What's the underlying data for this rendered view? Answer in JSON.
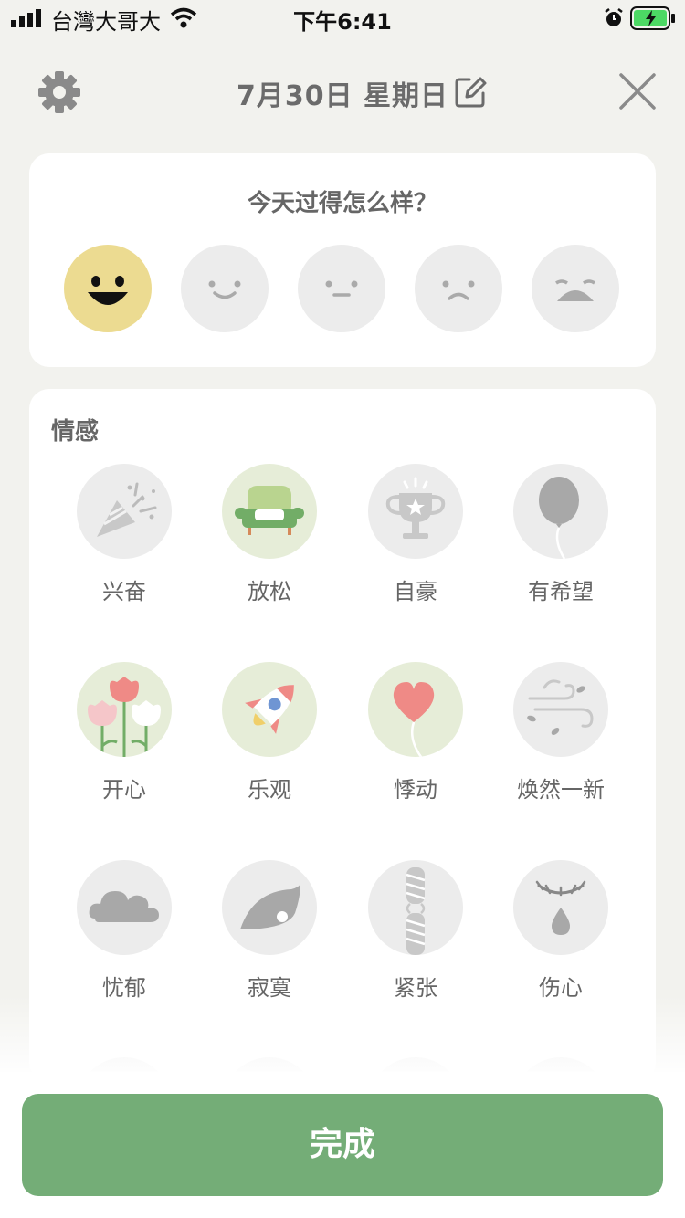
{
  "status_bar": {
    "carrier": "台灣大哥大",
    "time": "下午6:41"
  },
  "header": {
    "date_title": "7月30日 星期日"
  },
  "mood": {
    "question": "今天过得怎么样？",
    "faces": [
      "very-happy-face",
      "happy-face",
      "neutral-face",
      "sad-face",
      "crying-face"
    ],
    "selected_index": 0
  },
  "emotions": {
    "section_title": "情感",
    "items": [
      {
        "label": "兴奋",
        "icon": "party-popper-icon",
        "selected": false
      },
      {
        "label": "放松",
        "icon": "armchair-icon",
        "selected": true
      },
      {
        "label": "自豪",
        "icon": "trophy-icon",
        "selected": false
      },
      {
        "label": "有希望",
        "icon": "balloon-icon",
        "selected": false
      },
      {
        "label": "开心",
        "icon": "tulips-icon",
        "selected": true
      },
      {
        "label": "乐观",
        "icon": "rocket-icon",
        "selected": true
      },
      {
        "label": "悸动",
        "icon": "heart-balloon-icon",
        "selected": true
      },
      {
        "label": "焕然一新",
        "icon": "breeze-icon",
        "selected": false
      },
      {
        "label": "忧郁",
        "icon": "cloud-icon",
        "selected": false
      },
      {
        "label": "寂寞",
        "icon": "leaf-icon",
        "selected": false
      },
      {
        "label": "紧张",
        "icon": "twisted-rope-icon",
        "selected": false
      },
      {
        "label": "伤心",
        "icon": "teardrop-icon",
        "selected": false
      }
    ]
  },
  "footer": {
    "done_label": "完成"
  },
  "colors": {
    "accent_green": "#74ad77",
    "selected_face": "#ecdb91",
    "selected_bg": "#e6edd8"
  }
}
